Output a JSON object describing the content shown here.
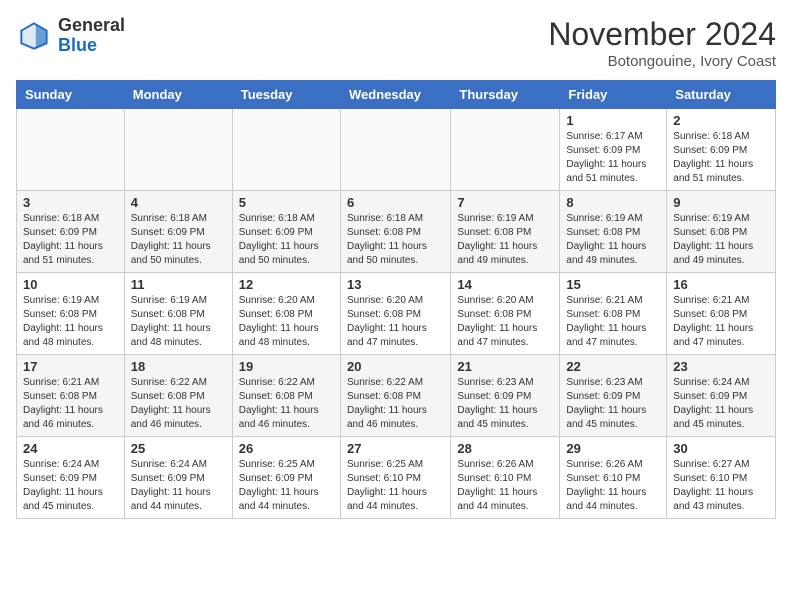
{
  "logo": {
    "general": "General",
    "blue": "Blue"
  },
  "header": {
    "month": "November 2024",
    "location": "Botongouine, Ivory Coast"
  },
  "weekdays": [
    "Sunday",
    "Monday",
    "Tuesday",
    "Wednesday",
    "Thursday",
    "Friday",
    "Saturday"
  ],
  "weeks": [
    [
      {
        "day": "",
        "detail": ""
      },
      {
        "day": "",
        "detail": ""
      },
      {
        "day": "",
        "detail": ""
      },
      {
        "day": "",
        "detail": ""
      },
      {
        "day": "",
        "detail": ""
      },
      {
        "day": "1",
        "detail": "Sunrise: 6:17 AM\nSunset: 6:09 PM\nDaylight: 11 hours and 51 minutes."
      },
      {
        "day": "2",
        "detail": "Sunrise: 6:18 AM\nSunset: 6:09 PM\nDaylight: 11 hours and 51 minutes."
      }
    ],
    [
      {
        "day": "3",
        "detail": "Sunrise: 6:18 AM\nSunset: 6:09 PM\nDaylight: 11 hours and 51 minutes."
      },
      {
        "day": "4",
        "detail": "Sunrise: 6:18 AM\nSunset: 6:09 PM\nDaylight: 11 hours and 50 minutes."
      },
      {
        "day": "5",
        "detail": "Sunrise: 6:18 AM\nSunset: 6:09 PM\nDaylight: 11 hours and 50 minutes."
      },
      {
        "day": "6",
        "detail": "Sunrise: 6:18 AM\nSunset: 6:08 PM\nDaylight: 11 hours and 50 minutes."
      },
      {
        "day": "7",
        "detail": "Sunrise: 6:19 AM\nSunset: 6:08 PM\nDaylight: 11 hours and 49 minutes."
      },
      {
        "day": "8",
        "detail": "Sunrise: 6:19 AM\nSunset: 6:08 PM\nDaylight: 11 hours and 49 minutes."
      },
      {
        "day": "9",
        "detail": "Sunrise: 6:19 AM\nSunset: 6:08 PM\nDaylight: 11 hours and 49 minutes."
      }
    ],
    [
      {
        "day": "10",
        "detail": "Sunrise: 6:19 AM\nSunset: 6:08 PM\nDaylight: 11 hours and 48 minutes."
      },
      {
        "day": "11",
        "detail": "Sunrise: 6:19 AM\nSunset: 6:08 PM\nDaylight: 11 hours and 48 minutes."
      },
      {
        "day": "12",
        "detail": "Sunrise: 6:20 AM\nSunset: 6:08 PM\nDaylight: 11 hours and 48 minutes."
      },
      {
        "day": "13",
        "detail": "Sunrise: 6:20 AM\nSunset: 6:08 PM\nDaylight: 11 hours and 47 minutes."
      },
      {
        "day": "14",
        "detail": "Sunrise: 6:20 AM\nSunset: 6:08 PM\nDaylight: 11 hours and 47 minutes."
      },
      {
        "day": "15",
        "detail": "Sunrise: 6:21 AM\nSunset: 6:08 PM\nDaylight: 11 hours and 47 minutes."
      },
      {
        "day": "16",
        "detail": "Sunrise: 6:21 AM\nSunset: 6:08 PM\nDaylight: 11 hours and 47 minutes."
      }
    ],
    [
      {
        "day": "17",
        "detail": "Sunrise: 6:21 AM\nSunset: 6:08 PM\nDaylight: 11 hours and 46 minutes."
      },
      {
        "day": "18",
        "detail": "Sunrise: 6:22 AM\nSunset: 6:08 PM\nDaylight: 11 hours and 46 minutes."
      },
      {
        "day": "19",
        "detail": "Sunrise: 6:22 AM\nSunset: 6:08 PM\nDaylight: 11 hours and 46 minutes."
      },
      {
        "day": "20",
        "detail": "Sunrise: 6:22 AM\nSunset: 6:08 PM\nDaylight: 11 hours and 46 minutes."
      },
      {
        "day": "21",
        "detail": "Sunrise: 6:23 AM\nSunset: 6:09 PM\nDaylight: 11 hours and 45 minutes."
      },
      {
        "day": "22",
        "detail": "Sunrise: 6:23 AM\nSunset: 6:09 PM\nDaylight: 11 hours and 45 minutes."
      },
      {
        "day": "23",
        "detail": "Sunrise: 6:24 AM\nSunset: 6:09 PM\nDaylight: 11 hours and 45 minutes."
      }
    ],
    [
      {
        "day": "24",
        "detail": "Sunrise: 6:24 AM\nSunset: 6:09 PM\nDaylight: 11 hours and 45 minutes."
      },
      {
        "day": "25",
        "detail": "Sunrise: 6:24 AM\nSunset: 6:09 PM\nDaylight: 11 hours and 44 minutes."
      },
      {
        "day": "26",
        "detail": "Sunrise: 6:25 AM\nSunset: 6:09 PM\nDaylight: 11 hours and 44 minutes."
      },
      {
        "day": "27",
        "detail": "Sunrise: 6:25 AM\nSunset: 6:10 PM\nDaylight: 11 hours and 44 minutes."
      },
      {
        "day": "28",
        "detail": "Sunrise: 6:26 AM\nSunset: 6:10 PM\nDaylight: 11 hours and 44 minutes."
      },
      {
        "day": "29",
        "detail": "Sunrise: 6:26 AM\nSunset: 6:10 PM\nDaylight: 11 hours and 44 minutes."
      },
      {
        "day": "30",
        "detail": "Sunrise: 6:27 AM\nSunset: 6:10 PM\nDaylight: 11 hours and 43 minutes."
      }
    ]
  ]
}
